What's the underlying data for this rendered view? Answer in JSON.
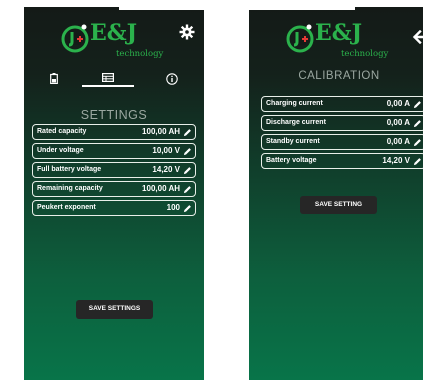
{
  "brand": {
    "logo_text": "E&J",
    "logo_sub": "technology",
    "accent_color": "#2bb24c"
  },
  "settings_screen": {
    "tabs": [
      {
        "icon": "battery-icon"
      },
      {
        "icon": "table-icon",
        "active": true
      },
      {
        "icon": "info-icon"
      }
    ],
    "title": "SETTINGS",
    "rows": [
      {
        "label": "Rated capacity",
        "value": "100,00 AH"
      },
      {
        "label": "Under voltage",
        "value": "10,00 V"
      },
      {
        "label": "Full battery voltage",
        "value": "14,20 V"
      },
      {
        "label": "Remaining capacity",
        "value": "100,00 AH"
      },
      {
        "label": "Peukert exponent",
        "value": "100"
      }
    ],
    "button": "SAVE SETTINGS"
  },
  "calibration_screen": {
    "title": "CALIBRATION",
    "rows": [
      {
        "label": "Charging current",
        "value": "0,00 A"
      },
      {
        "label": "Discharge current",
        "value": "0,00 A"
      },
      {
        "label": "Standby current",
        "value": "0,00 A"
      },
      {
        "label": "Battery voltage",
        "value": "14,20 V"
      }
    ],
    "button": "SAVE SETTING"
  }
}
